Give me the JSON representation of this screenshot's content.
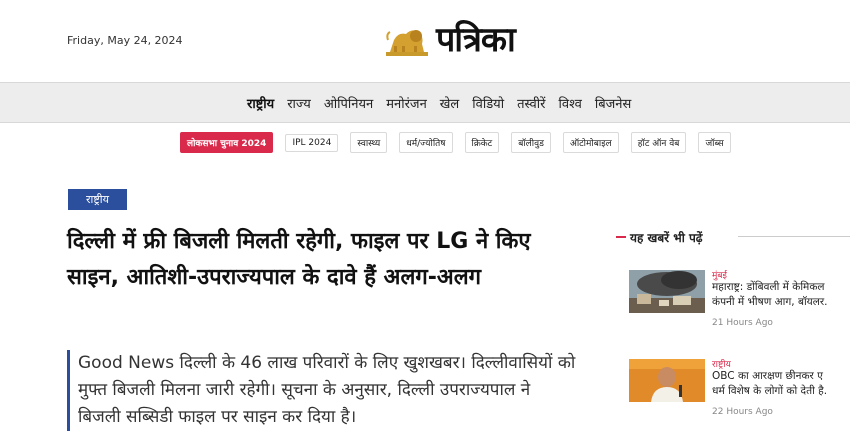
{
  "header": {
    "date": "Friday, May 24, 2024",
    "logo_text": "पत्रिका"
  },
  "nav": {
    "items": [
      "राष्ट्रीय",
      "राज्य",
      "ओपिनियन",
      "मनोरंजन",
      "खेल",
      "विडियो",
      "तस्वीरें",
      "विश्व",
      "बिजनेस"
    ],
    "active": "राष्ट्रीय"
  },
  "tags": [
    "लोकसभा चुनाव 2024",
    "IPL 2024",
    "स्वास्थ्य",
    "धर्म/ज्योतिष",
    "क्रिकेट",
    "बॉलीवुड",
    "ऑटोमोबाइल",
    "हॉट ऑन वेब",
    "जॉब्स"
  ],
  "article": {
    "category": "राष्ट्रीय",
    "headline": "दिल्ली में फ्री बिजली मिलती रहेगी, फाइल पर LG ने किए साइन, आतिशी-उपराज्यपाल के दावे हैं अलग-अलग",
    "summary": "Good News दिल्ली के 46 लाख परिवारों के लिए खुशखबर। दिल्लीवासियों को मुफ्त बिजली मिलना जारी रहेगी। सूचना के अनुसार, दिल्ली उपराज्यपाल ने बिजली सब्सिडी फाइल पर साइन कर दिया है।"
  },
  "sidebar": {
    "title": "यह खबरें भी पढ़ें",
    "news": [
      {
        "category": "मुंबई",
        "title": "महाराष्ट्र: डोंबिवली में केमिकल\nकंपनी में भीषण आग, बॉयलर.",
        "time": "21 Hours Ago"
      },
      {
        "category": "राष्ट्रीय",
        "title": "OBC का आरक्षण छीनकर ए\nधर्म विशेष के लोगों को देती है.",
        "time": "22 Hours Ago"
      }
    ]
  },
  "colors": {
    "accent": "#d92a4c",
    "category_bg": "#2b4f9c",
    "nav_bg": "#ededed"
  }
}
